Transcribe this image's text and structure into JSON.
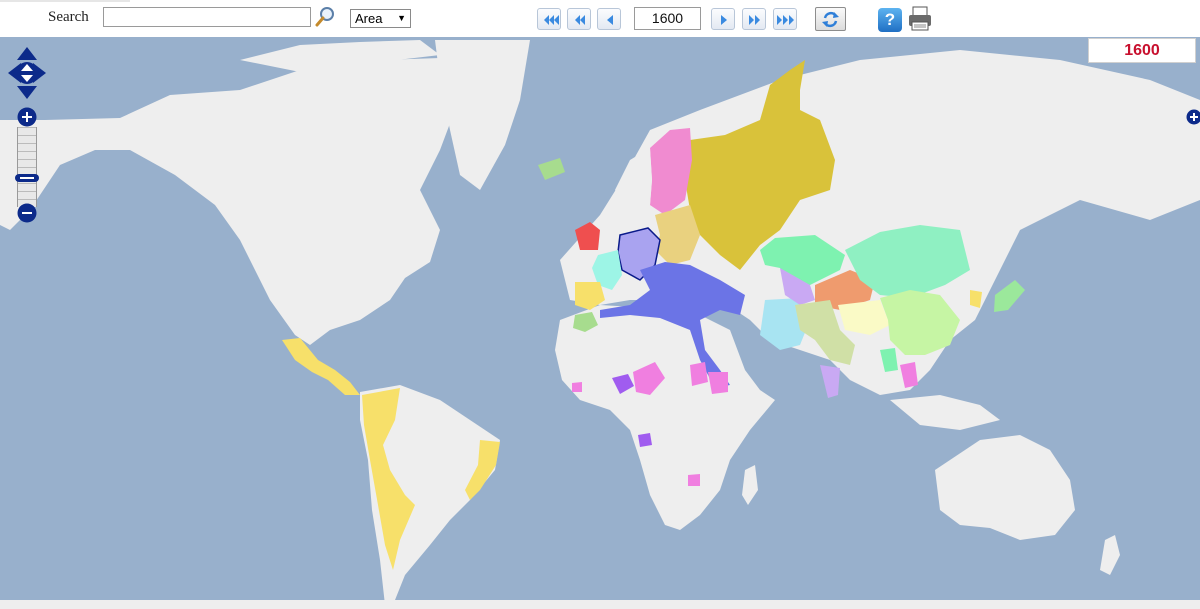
{
  "toolbar": {
    "search_label": "Search",
    "search_value": "",
    "area_select": "Area",
    "year_value": "1600",
    "nav_buttons": [
      "first-icon",
      "rewind-icon",
      "previous-icon",
      "next-icon",
      "fast-forward-icon",
      "last-icon"
    ],
    "icons": {
      "search": "magnifier-icon",
      "refresh": "refresh-icon",
      "help": "help-icon",
      "print": "printer-icon"
    },
    "help_glyph": "?"
  },
  "map": {
    "year_display": "1600",
    "controls": [
      "pan-icon",
      "zoom-in-icon",
      "zoom-handle",
      "zoom-out-icon",
      "expand-icon"
    ],
    "colors": {
      "ocean": "#98b0cc",
      "land": "#eeeeee",
      "year_text": "#c8102e",
      "russia": "#d9c23a",
      "americas_spain": "#f7e06a",
      "ottoman": "#6b74e6",
      "poland": "#e9d17f",
      "sweden": "#f08bd0",
      "england": "#ef4f4f",
      "france": "#9df5e6",
      "hre": "#a9a3f0",
      "persia": "#a8e4f2",
      "mughal": "#d0e0a6",
      "ming": "#c6f5a4",
      "central_asia": "#7ef2b0",
      "mongols": "#8ff0c2",
      "kazakh": "#ef9b6e",
      "tibet": "#fafac6",
      "uzbek": "#c9a9f3",
      "sub_saharan": "#f07fe0",
      "songhai": "#a05cef",
      "greenland_norse": "#a7dc8e",
      "japan": "#9be89b"
    }
  }
}
